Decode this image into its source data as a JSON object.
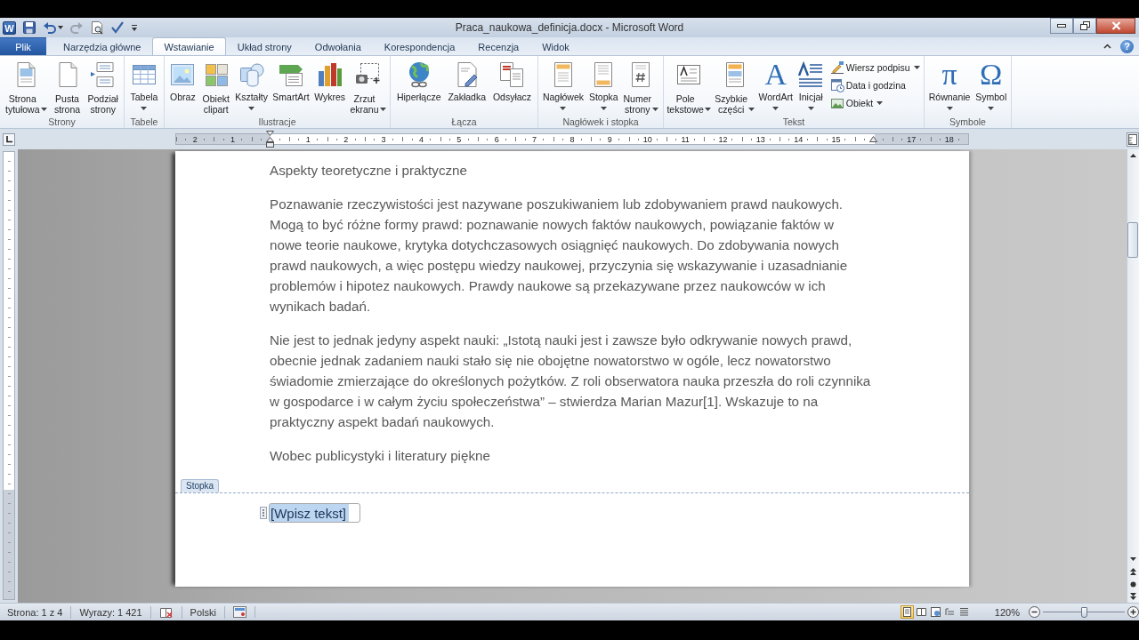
{
  "window": {
    "app_icon": "W",
    "title": "Praca_naukowa_definicja.docx - Microsoft Word",
    "help": "?"
  },
  "tabs": [
    {
      "label": "Plik",
      "kind": "file",
      "selected": false
    },
    {
      "label": "Narzędzia główne",
      "kind": "tab",
      "selected": false
    },
    {
      "label": "Wstawianie",
      "kind": "tab",
      "selected": true
    },
    {
      "label": "Układ strony",
      "kind": "tab",
      "selected": false
    },
    {
      "label": "Odwołania",
      "kind": "tab",
      "selected": false
    },
    {
      "label": "Korespondencja",
      "kind": "tab",
      "selected": false
    },
    {
      "label": "Recenzja",
      "kind": "tab",
      "selected": false
    },
    {
      "label": "Widok",
      "kind": "tab",
      "selected": false
    }
  ],
  "ribbon": {
    "groups": [
      {
        "label": "Strony",
        "buttons": [
          {
            "label": "Strona tytułowa",
            "kind": "large",
            "dropdown": true
          },
          {
            "label": "Pusta strona",
            "kind": "large",
            "dropdown": false
          },
          {
            "label": "Podział strony",
            "kind": "large",
            "dropdown": false
          }
        ]
      },
      {
        "label": "Tabele",
        "buttons": [
          {
            "label": "Tabela",
            "kind": "large",
            "dropdown": true
          }
        ]
      },
      {
        "label": "Ilustracje",
        "buttons": [
          {
            "label": "Obraz",
            "kind": "large",
            "dropdown": false
          },
          {
            "label": "Obiekt clipart",
            "kind": "large",
            "dropdown": false
          },
          {
            "label": "Kształty",
            "kind": "large",
            "dropdown": true
          },
          {
            "label": "SmartArt",
            "kind": "large",
            "dropdown": false
          },
          {
            "label": "Wykres",
            "kind": "large",
            "dropdown": false
          },
          {
            "label": "Zrzut ekranu",
            "kind": "large",
            "dropdown": true
          }
        ]
      },
      {
        "label": "Łącza",
        "buttons": [
          {
            "label": "Hiperłącze",
            "kind": "large",
            "dropdown": false
          },
          {
            "label": "Zakładka",
            "kind": "large",
            "dropdown": false
          },
          {
            "label": "Odsyłacz",
            "kind": "large",
            "dropdown": false
          }
        ]
      },
      {
        "label": "Nagłówek i stopka",
        "buttons": [
          {
            "label": "Nagłówek",
            "kind": "large",
            "dropdown": true
          },
          {
            "label": "Stopka",
            "kind": "large",
            "dropdown": true
          },
          {
            "label": "Numer strony",
            "kind": "large",
            "dropdown": true
          }
        ]
      },
      {
        "label": "Tekst",
        "buttons": [
          {
            "label": "Pole tekstowe",
            "kind": "large",
            "dropdown": true
          },
          {
            "label": "Szybkie części",
            "kind": "large",
            "dropdown": true
          },
          {
            "label": "WordArt",
            "kind": "large",
            "dropdown": true,
            "glyph": "A"
          },
          {
            "label": "Inicjał",
            "kind": "large",
            "dropdown": true
          },
          {
            "label": "Wiersz podpisu",
            "kind": "small",
            "dropdown": true
          },
          {
            "label": "Data i godzina",
            "kind": "small",
            "dropdown": false
          },
          {
            "label": "Obiekt",
            "kind": "small",
            "dropdown": true
          }
        ]
      },
      {
        "label": "Symbole",
        "buttons": [
          {
            "label": "Równanie",
            "kind": "large",
            "dropdown": true,
            "glyph": "π"
          },
          {
            "label": "Symbol",
            "kind": "large",
            "dropdown": true,
            "glyph": "Ω"
          }
        ]
      }
    ]
  },
  "ruler": {
    "marks": [
      {
        "kind": "number",
        "label": "2"
      },
      {
        "kind": "number",
        "label": "1"
      },
      {
        "kind": "left_indent"
      },
      {
        "kind": "number",
        "label": "1"
      },
      {
        "kind": "number",
        "label": "2"
      },
      {
        "kind": "number",
        "label": "3"
      },
      {
        "kind": "number",
        "label": "4"
      },
      {
        "kind": "number",
        "label": "5"
      },
      {
        "kind": "number",
        "label": "6"
      },
      {
        "kind": "number",
        "label": "7"
      },
      {
        "kind": "number",
        "label": "8"
      },
      {
        "kind": "number",
        "label": "9"
      },
      {
        "kind": "number",
        "label": "10"
      },
      {
        "kind": "number",
        "label": "11"
      },
      {
        "kind": "number",
        "label": "12"
      },
      {
        "kind": "number",
        "label": "13"
      },
      {
        "kind": "number",
        "label": "14"
      },
      {
        "kind": "number",
        "label": "15"
      },
      {
        "kind": "right_indent"
      },
      {
        "kind": "number",
        "label": "17"
      },
      {
        "kind": "number",
        "label": "18"
      }
    ]
  },
  "document": {
    "paragraphs": [
      {
        "lines": [
          "Aspekty teoretyczne i praktyczne"
        ]
      },
      {
        "lines": [
          "Poznawanie rzeczywistości jest nazywane poszukiwaniem lub zdobywaniem prawd naukowych.",
          "Mogą to być różne formy prawd: poznawanie nowych faktów naukowych, powiązanie faktów w",
          "nowe teorie naukowe, krytyka dotychczasowych osiągnięć naukowych. Do zdobywania nowych",
          "prawd naukowych, a więc postępu wiedzy naukowej, przyczynia się wskazywanie i uzasadnianie",
          "problemów i hipotez naukowych. Prawdy naukowe są przekazywane przez naukowców w ich",
          "wynikach badań."
        ]
      },
      {
        "lines": [
          "Nie jest to jednak jedyny aspekt nauki: „Istotą nauki jest i zawsze było odkrywanie nowych prawd,",
          "obecnie jednak zadaniem nauki stało się nie obojętne nowatorstwo w ogóle, lecz nowatorstwo",
          "świadomie zmierzające do określonych pożytków. Z roli obserwatora nauka przeszła do roli czynnika",
          "w gospodarce i w całym życiu społeczeństwa” – stwierdza Marian Mazur[1]. Wskazuje to na",
          "praktyczny aspekt badań naukowych."
        ]
      },
      {
        "lines": [
          "Wobec publicystyki i literatury piękne"
        ]
      }
    ],
    "footer": {
      "label": "Stopka",
      "field": {
        "placeholder": "[Wpisz tekst]",
        "selected": true
      }
    }
  },
  "status_bar": {
    "page": "Strona: 1 z 4",
    "words": "Wyrazy: 1 421",
    "language": "Polski",
    "views": [
      {
        "selected": true
      },
      {
        "selected": false
      },
      {
        "selected": false
      },
      {
        "selected": false
      },
      {
        "selected": false
      }
    ],
    "zoom": "120%",
    "zoom_slider": {
      "level": 0.5
    }
  }
}
